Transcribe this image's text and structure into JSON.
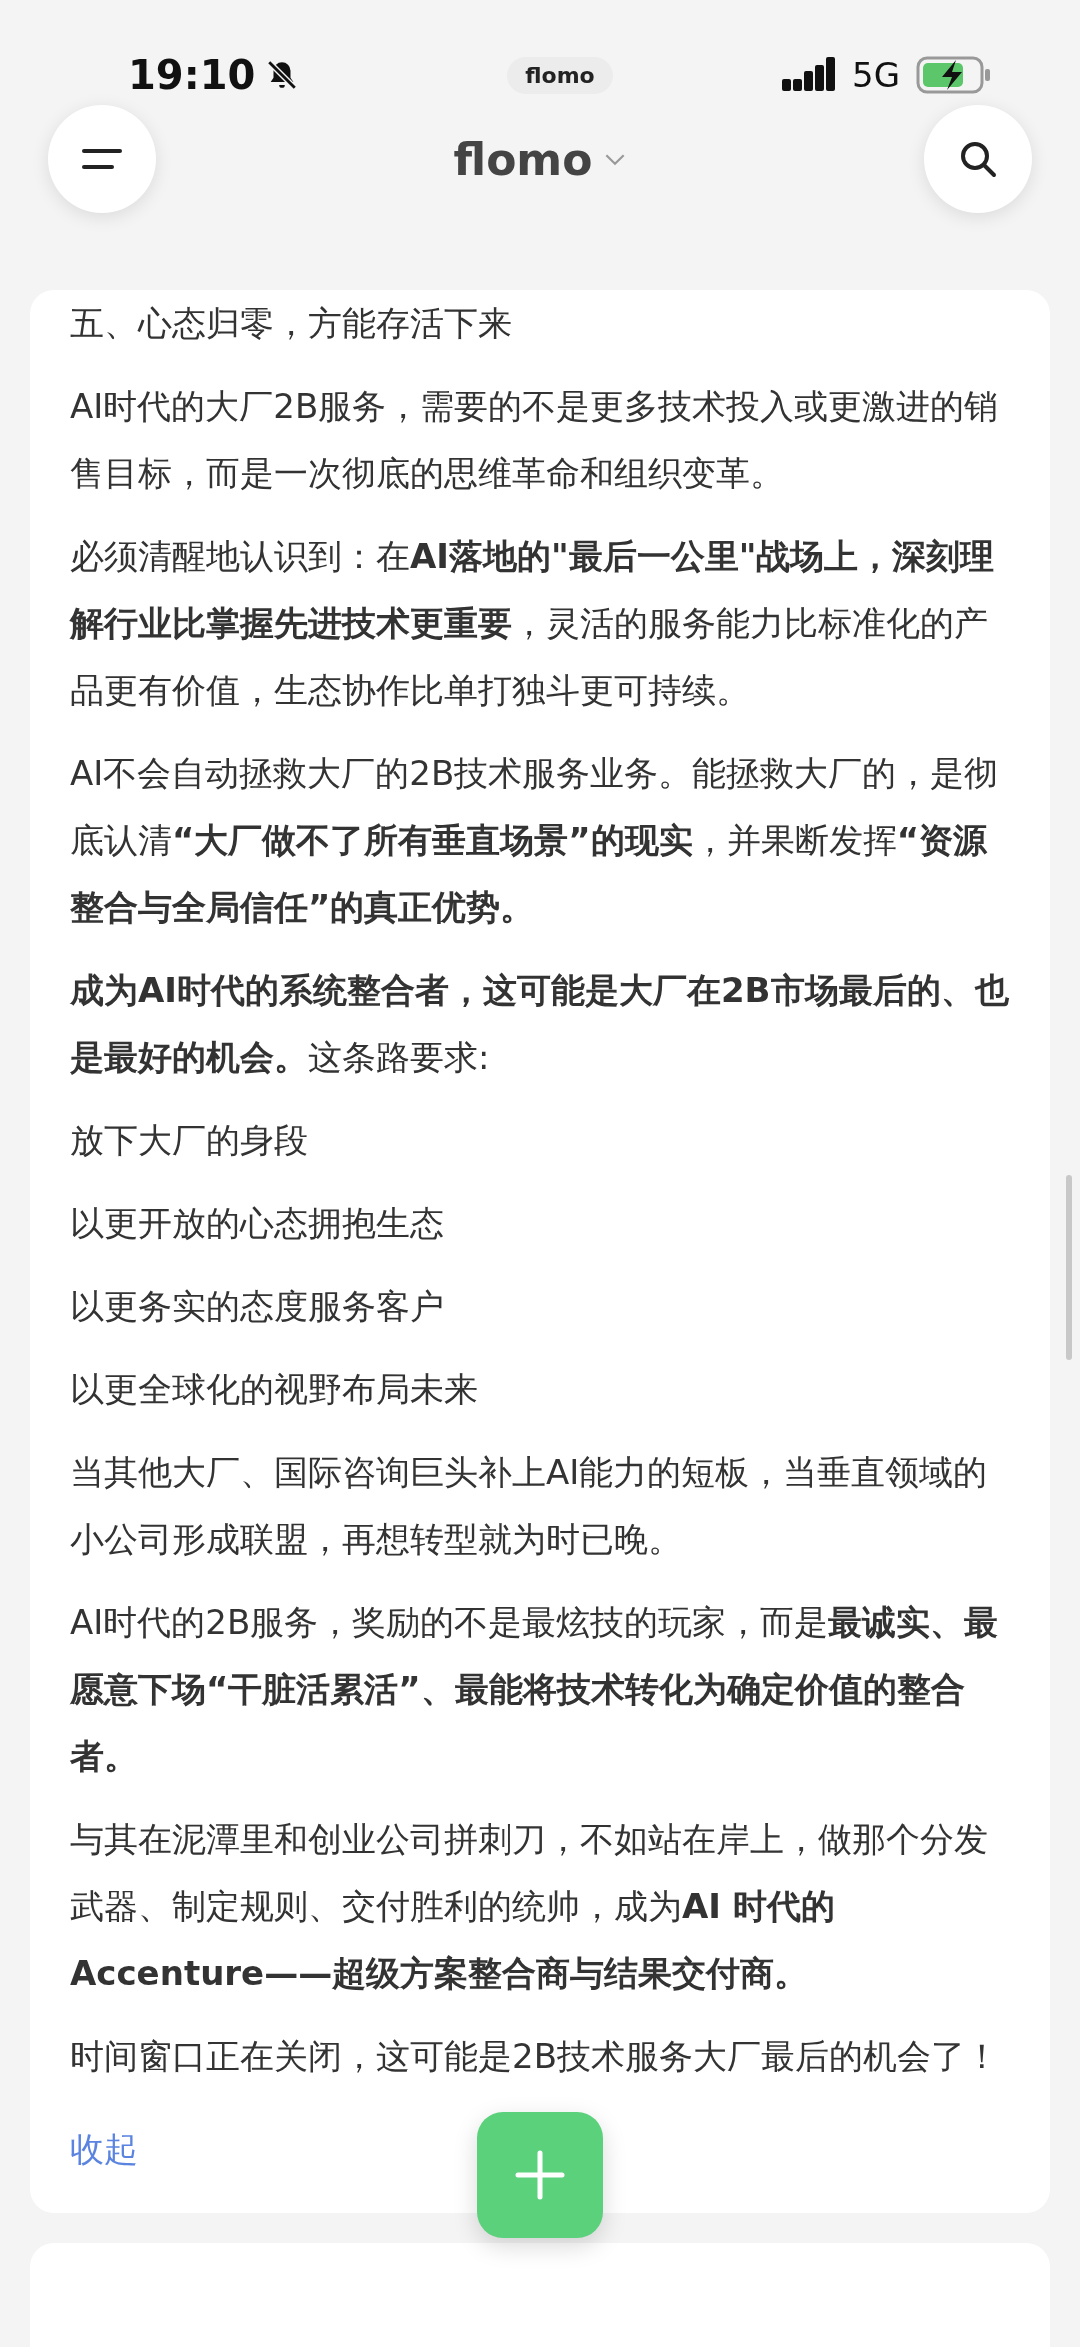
{
  "status_bar": {
    "time": "19:10",
    "app_pill": "flomo",
    "network": "5G"
  },
  "header": {
    "title": "flomo"
  },
  "memo": {
    "paragraphs": [
      "五、心态归零，方能存活下来",
      "AI时代的大厂2B服务，需要的不是更多技术投入或更激进的销售目标，而是一次彻底的思维革命和组织变革。",
      "必须清醒地认识到：在**AI落地的\"最后一公里\"战场上，深刻理解行业比掌握先进技术更重要**，灵活的服务能力比标准化的产品更有价值，生态协作比单打独斗更可持续。",
      "AI不会自动拯救大厂的2B技术服务业务。能拯救大厂的，是彻底认清**“大厂做不了所有垂直场景”的现实**，并果断发挥**“资源整合与全局信任”的真正优势。**",
      "**成为AI时代的系统整合者，这可能是大厂在2B市场最后的、也是最好的机会。**这条路要求:",
      "放下大厂的身段",
      "以更开放的心态拥抱生态",
      "以更务实的态度服务客户",
      "以更全球化的视野布局未来",
      "当其他大厂、国际咨询巨头补上AI能力的短板，当垂直领域的小公司形成联盟，再想转型就为时已晚。",
      "AI时代的2B服务，奖励的不是最炫技的玩家，而是**最诚实、最愿意下场“干脏活累活”、最能将技术转化为确定价值的整合者。**",
      "与其在泥潭里和创业公司拼刺刀，不如站在岸上，做那个分发武器、制定规则、交付胜利的统帅，成为**AI 时代的Accenture——超级方案整合商与结果交付商。**",
      "时间窗口正在关闭，这可能是2B技术服务大厂最后的机会了！"
    ],
    "collapse_link": "收起"
  }
}
